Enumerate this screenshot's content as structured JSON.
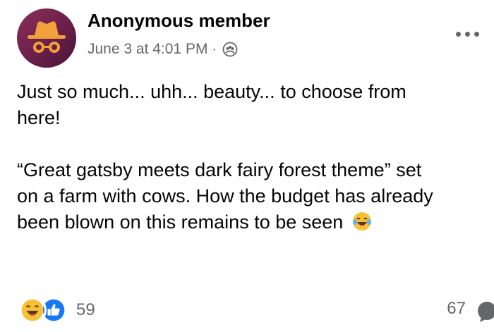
{
  "post": {
    "author": "Anonymous member",
    "timestamp": "June 3 at 4:01 PM",
    "separator": "·",
    "audience_icon": "members-group-icon",
    "more_icon": "more-options-icon",
    "body": {
      "line1": "Just so much... uhh... beauty... to choose from",
      "line2": "here!",
      "line3": "“Great gatsby meets dark fairy forest theme” set",
      "line4": "on a farm with cows. How the budget has already",
      "line5": "been blown on this remains to be seen"
    },
    "inline_emoji": "laughing-tears-emoji"
  },
  "engagement": {
    "reaction_icons": [
      "haha-reaction-icon",
      "like-reaction-icon"
    ],
    "reaction_count": "59",
    "comment_count": "67",
    "comment_icon": "comment-icon"
  },
  "colors": {
    "avatar_bg": "#6a1f4a",
    "avatar_glyph": "#f2a13a",
    "secondary_text": "#65676b",
    "like_blue": "#1877f2",
    "haha_yellow": "#f7c136"
  }
}
